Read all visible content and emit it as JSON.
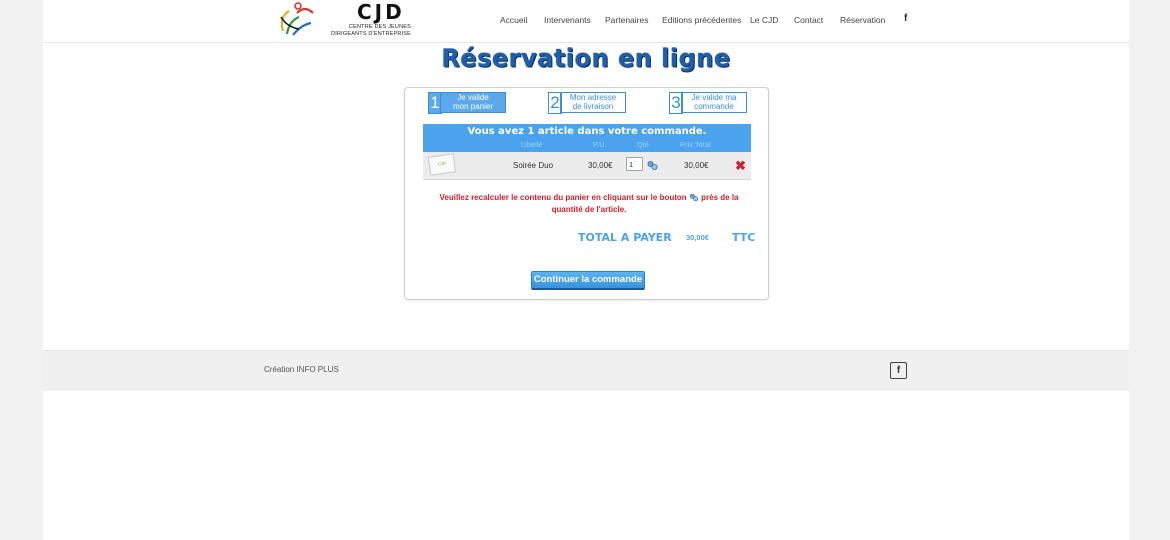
{
  "brand": {
    "logo_text": "CJD",
    "logo_subtitle": "CENTRE DES JEUNES DIRIGEANTS D'ENTREPRISE"
  },
  "nav": {
    "items": [
      "Accueil",
      "Intervenants",
      "Partenaires",
      "Editions précédentes",
      "Le CJD",
      "Contact",
      "Réservation"
    ],
    "facebook_icon": "f"
  },
  "page_title": "Réservation en ligne",
  "steps": [
    {
      "number": "1",
      "label_line1": "Je valide",
      "label_line2": "mon panier",
      "active": true
    },
    {
      "number": "2",
      "label_line1": "Mon adresse",
      "label_line2": "de livraison",
      "active": false
    },
    {
      "number": "3",
      "label_line1": "Je valide ma",
      "label_line2": "commande",
      "active": false
    }
  ],
  "cart": {
    "summary": "Vous avez 1 article dans votre commande.",
    "columns": [
      "Libellé",
      "P.U.",
      "Qté",
      "Prix Total"
    ],
    "rows": [
      {
        "thumbnail_label": "CJD",
        "label": "Soirée Duo",
        "unit_price": "30,00€",
        "quantity": "1",
        "total": "30,00€"
      }
    ],
    "warning_part1": "Veuillez recalculer le contenu du panier en cliquant sur le bouton",
    "warning_part2": "près de la quantité de l'article.",
    "total_label": "TOTAL A PAYER",
    "total_amount": "30,00€",
    "total_suffix": "TTC",
    "continue_label": "Continuer la commande"
  },
  "footer": {
    "credit": "Création INFO PLUS",
    "facebook_icon": "f"
  },
  "colors": {
    "accent_blue": "#4aa3ec",
    "title_blue": "#1f5ea8",
    "warning_red": "#d0202a"
  },
  "icons": [
    "facebook-icon",
    "refresh-icon",
    "delete-icon"
  ]
}
